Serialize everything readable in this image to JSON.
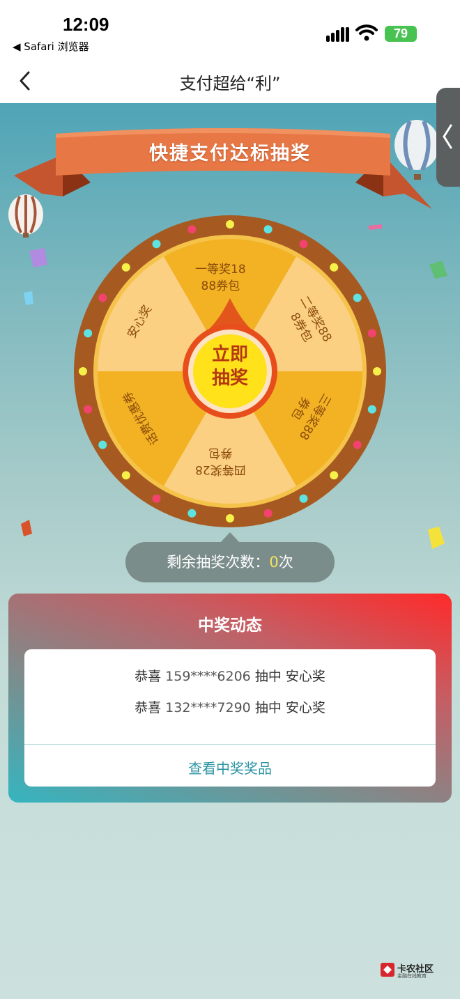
{
  "status_bar": {
    "time": "12:09",
    "back_app": "◀ Safari 浏览器",
    "battery": "79"
  },
  "nav": {
    "title": "支付超给“利”"
  },
  "banner": {
    "title": "快捷支付达标抽奖"
  },
  "wheel": {
    "segments": [
      {
        "label_line1": "一等奖18",
        "label_line2": "88券包"
      },
      {
        "label_line1": "二等奖88",
        "label_line2": "8券包"
      },
      {
        "label_line1": "三等奖88",
        "label_line2": "券包"
      },
      {
        "label_line1": "四等奖28",
        "label_line2": "券包"
      },
      {
        "label_line1": "话费优惠券",
        "label_line2": ""
      },
      {
        "label_line1": "安心奖",
        "label_line2": ""
      }
    ],
    "start_line1": "立即",
    "start_line2": "抽奖",
    "colors": {
      "rim": "#a65a22",
      "seg_light": "#fbd083",
      "seg_dark": "#f2b224",
      "button": "#ffe21a"
    }
  },
  "remaining": {
    "label": "剩余抽奖次数：",
    "count": "0",
    "unit": "次"
  },
  "news": {
    "title": "中奖动态",
    "wins": [
      {
        "prefix": "恭喜",
        "phone": "159****6206",
        "action": "抽中",
        "prize": "安心奖"
      },
      {
        "prefix": "恭喜",
        "phone": "132****7290",
        "action": "抽中",
        "prize": "安心奖"
      }
    ],
    "view_prizes": "查看中奖奖品"
  },
  "watermark": {
    "name": "卡农社区",
    "sub": "金融在线教育"
  }
}
